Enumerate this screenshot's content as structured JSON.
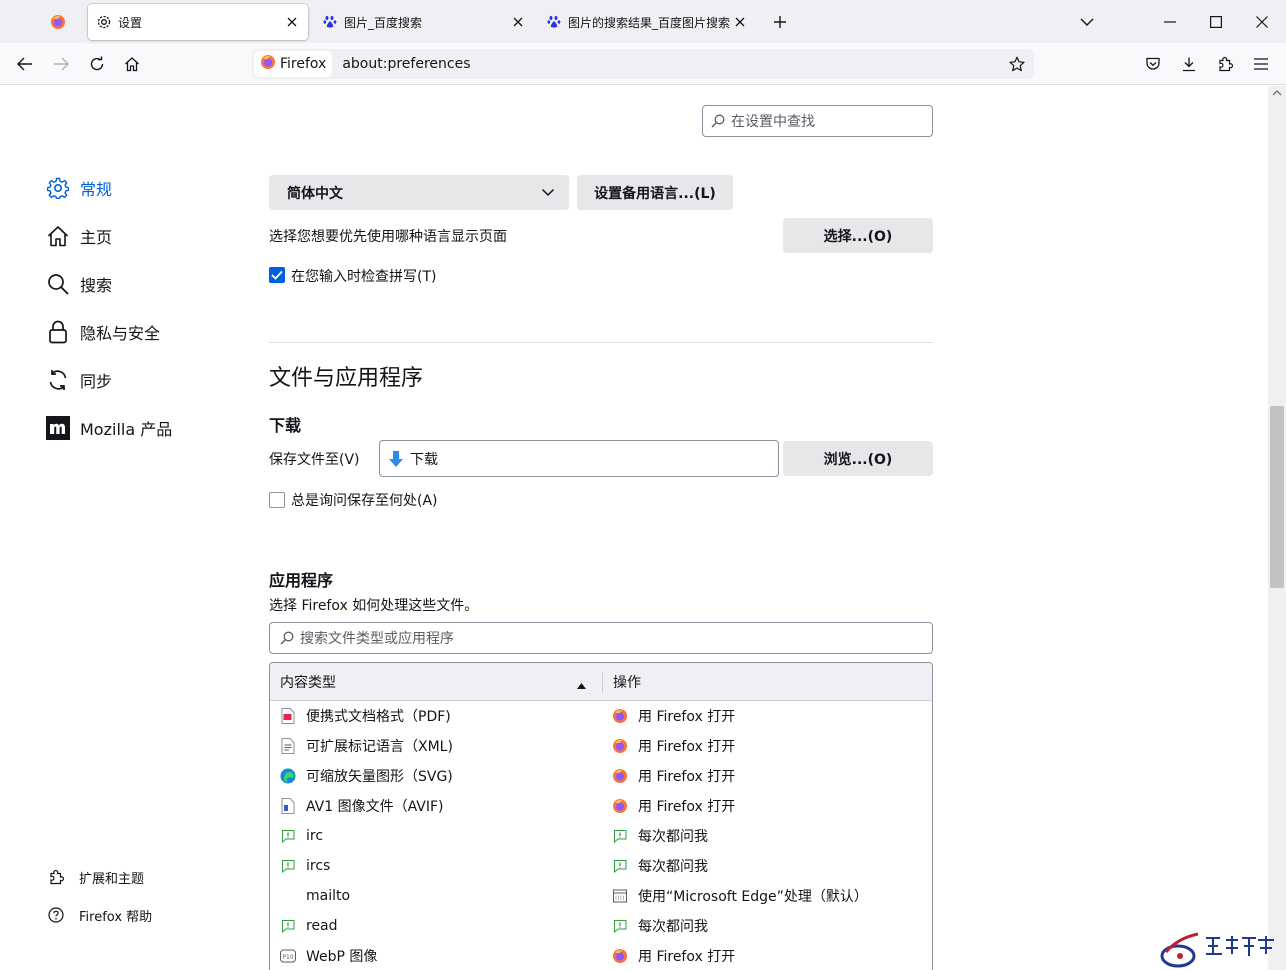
{
  "tabs": {
    "active_label": "设置",
    "tab2_label": "图片_百度搜索",
    "tab3_label": "图片的搜索结果_百度图片搜索"
  },
  "urlbar": {
    "identity": "Firefox",
    "url": "about:preferences"
  },
  "search_placeholder": "在设置中查找",
  "nav": {
    "general": "常规",
    "home": "主页",
    "search": "搜索",
    "privacy": "隐私与安全",
    "sync": "同步",
    "mozilla": "Mozilla 产品",
    "extensions": "扩展和主题",
    "help": "Firefox 帮助"
  },
  "language": {
    "selected": "简体中文",
    "alternates_button": "设置备用语言...(L)",
    "choose_text": "选择您想要优先使用哪种语言显示页面",
    "choose_button": "选择...(O)",
    "spellcheck_label": "在您输入时检查拼写(T)",
    "spellcheck_checked": true
  },
  "files_section": {
    "heading": "文件与应用程序",
    "downloads_heading": "下载",
    "save_to_label": "保存文件至(V)",
    "save_to_value": "下载",
    "browse_button": "浏览...(O)",
    "always_ask_label": "总是询问保存至何处(A)",
    "always_ask_checked": false
  },
  "applications": {
    "heading": "应用程序",
    "description": "选择 Firefox 如何处理这些文件。",
    "search_placeholder": "搜索文件类型或应用程序",
    "col_type": "内容类型",
    "col_action": "操作",
    "rows": [
      {
        "type": "便携式文档格式（PDF)",
        "type_icon": "pdf-icon",
        "action": "用 Firefox 打开",
        "action_icon": "firefox-icon"
      },
      {
        "type": "可扩展标记语言（XML)",
        "type_icon": "xml-file-icon",
        "action": "用 Firefox 打开",
        "action_icon": "firefox-icon"
      },
      {
        "type": "可缩放矢量图形（SVG)",
        "type_icon": "edge-icon",
        "action": "用 Firefox 打开",
        "action_icon": "firefox-icon"
      },
      {
        "type": "AV1 图像文件（AVIF)",
        "type_icon": "image-file-icon",
        "action": "用 Firefox 打开",
        "action_icon": "firefox-icon"
      },
      {
        "type": "irc",
        "type_icon": "chat-icon",
        "action": "每次都问我",
        "action_icon": "ask-icon"
      },
      {
        "type": "ircs",
        "type_icon": "chat-icon",
        "action": "每次都问我",
        "action_icon": "ask-icon"
      },
      {
        "type": "mailto",
        "type_icon": "",
        "action": "使用“Microsoft Edge”处理（默认）",
        "action_icon": "app-window-icon"
      },
      {
        "type": "read",
        "type_icon": "chat-icon",
        "action": "每次都问我",
        "action_icon": "ask-icon"
      },
      {
        "type": "WebP 图像",
        "type_icon": "webp-icon",
        "action": "用 Firefox 打开",
        "action_icon": "firefox-icon"
      }
    ]
  },
  "colors": {
    "accent": "#0061e0",
    "tabstrip": "#f0f0f4",
    "button": "#e7e7ea"
  }
}
